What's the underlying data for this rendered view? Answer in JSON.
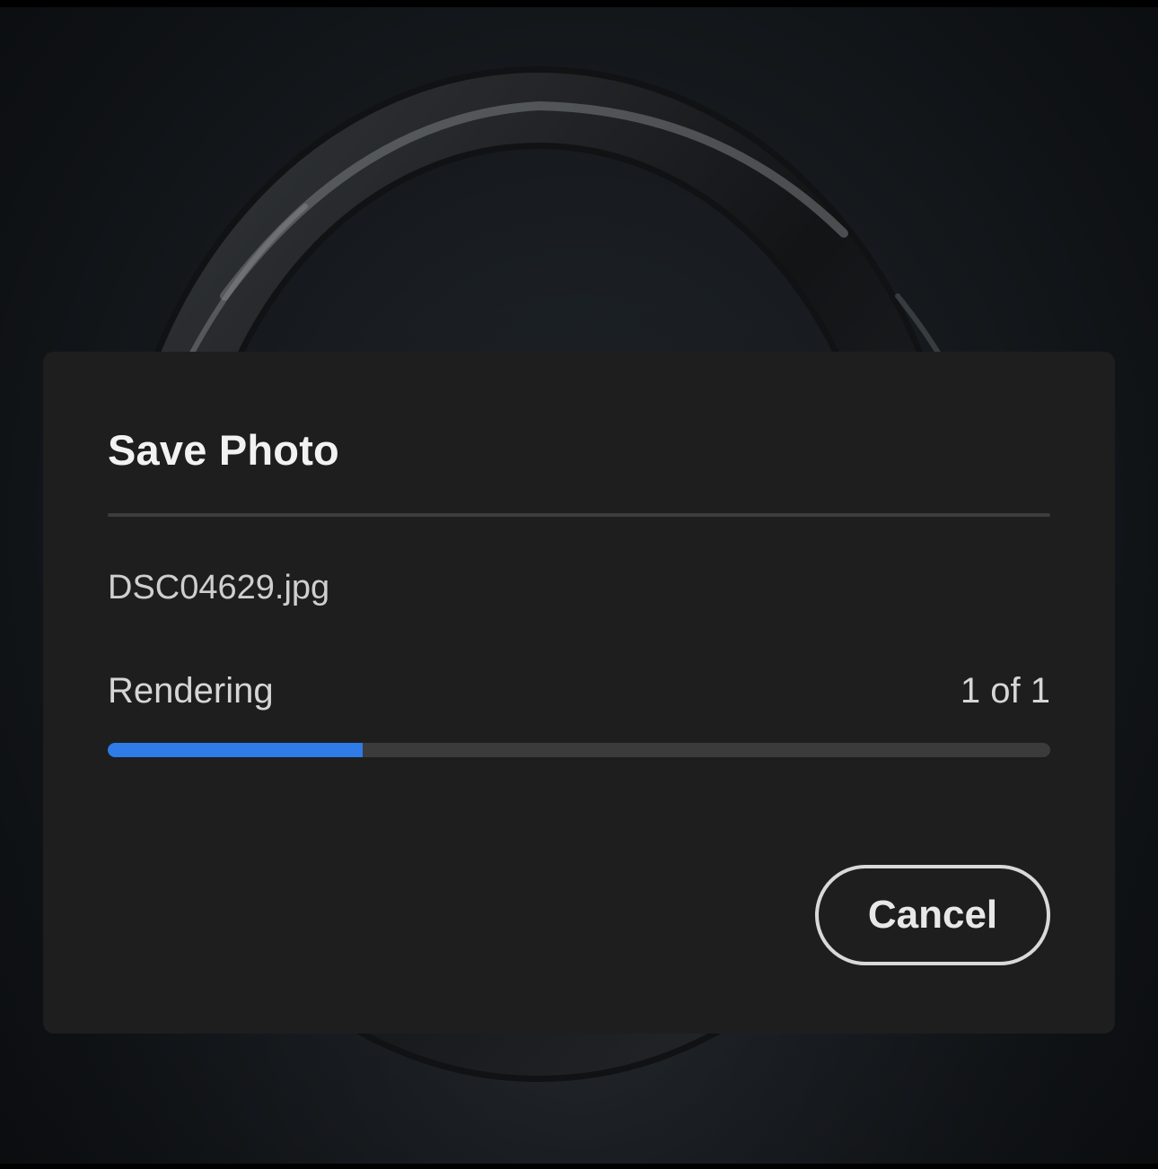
{
  "dialog": {
    "title": "Save Photo",
    "filename": "DSC04629.jpg",
    "status_label": "Rendering",
    "count_text": "1 of 1",
    "progress_fraction": 0.27,
    "cancel_label": "Cancel"
  },
  "colors": {
    "accent": "#2f7be8",
    "dialog_background": "#1e1e1e",
    "track": "#3b3b3b"
  }
}
